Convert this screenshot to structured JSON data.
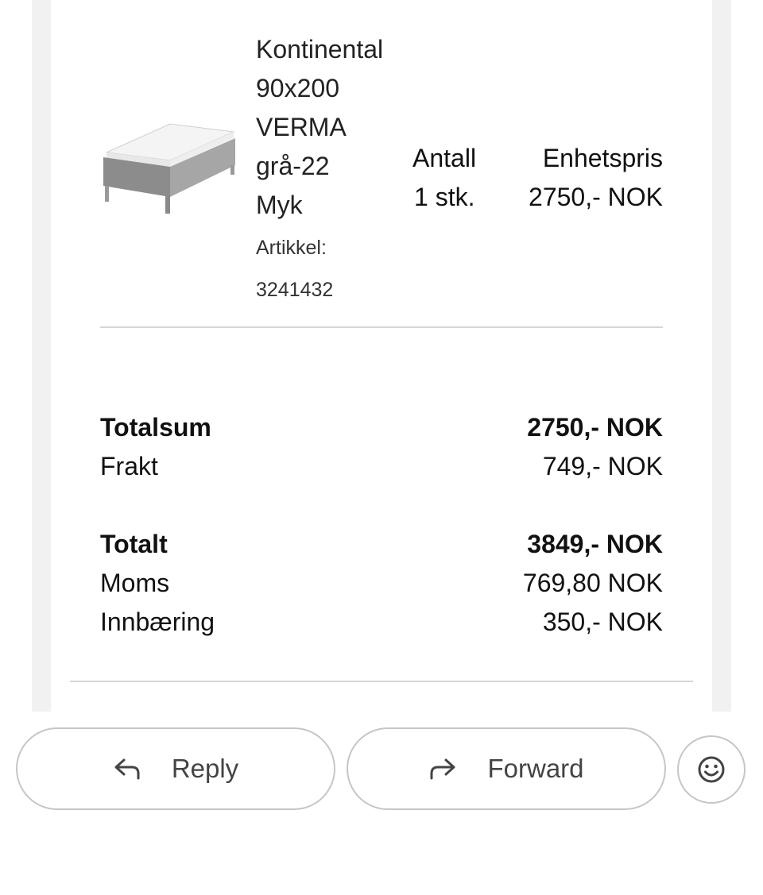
{
  "product": {
    "name_lines": [
      "Kontinental",
      "90x200",
      "VERMA",
      "grå-22",
      "Myk"
    ],
    "article_label": "Artikkel:",
    "article_number": "3241432",
    "quantity_header": "Antall",
    "quantity_value": "1 stk.",
    "unit_price_header": "Enhetspris",
    "unit_price_value": "2750,- NOK"
  },
  "summary": {
    "totalsum_label": "Totalsum",
    "totalsum_value": "2750,- NOK",
    "shipping_label": "Frakt",
    "shipping_value": "749,- NOK",
    "total_label": "Totalt",
    "total_value": "3849,- NOK",
    "vat_label": "Moms",
    "vat_value": "769,80 NOK",
    "carry_in_label": "Innbæring",
    "carry_in_value": "350,- NOK"
  },
  "actions": {
    "reply_label": "Reply",
    "forward_label": "Forward",
    "reply_icon": "reply-arrow-icon",
    "forward_icon": "forward-arrow-icon",
    "emoji_icon": "smiley-icon"
  }
}
